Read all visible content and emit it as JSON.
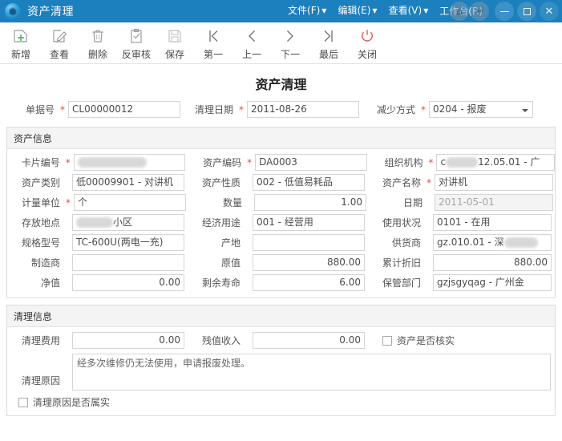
{
  "titlebar": {
    "app_title": "资产清理",
    "logo_icon": "app-logo-icon",
    "menus": [
      {
        "label": "文件(F)",
        "name": "menu-file"
      },
      {
        "label": "编辑(E)",
        "name": "menu-edit"
      },
      {
        "label": "查看(V)",
        "name": "menu-view"
      },
      {
        "label": "工作台(R)",
        "name": "menu-workbench"
      }
    ],
    "overlay_badges": [
      {
        "icon": "hanger-icon",
        "glyph": "⌂"
      },
      {
        "icon": "pin-icon",
        "glyph": "✄"
      }
    ],
    "window_controls": [
      {
        "name": "minimize-button",
        "icon": "minimize-icon"
      },
      {
        "name": "maximize-button",
        "icon": "maximize-icon"
      },
      {
        "name": "close-button",
        "icon": "close-icon",
        "glyph": "✕"
      }
    ],
    "accent_color": "#1c7fbe"
  },
  "toolbar": {
    "buttons": [
      {
        "label": "新增",
        "icon": "add-icon",
        "name": "toolbar-add"
      },
      {
        "label": "查看",
        "icon": "edit-view-icon",
        "name": "toolbar-view"
      },
      {
        "label": "删除",
        "icon": "trash-icon",
        "name": "toolbar-delete"
      },
      {
        "label": "反审核",
        "icon": "unaudit-clipboard-icon",
        "name": "toolbar-unaudit"
      },
      {
        "label": "保存",
        "icon": "save-floppy-icon",
        "name": "toolbar-save"
      },
      {
        "label": "第一",
        "icon": "first-record-icon",
        "name": "toolbar-first"
      },
      {
        "label": "上一",
        "icon": "prev-record-icon",
        "name": "toolbar-prev"
      },
      {
        "label": "下一",
        "icon": "next-record-icon",
        "name": "toolbar-next"
      },
      {
        "label": "最后",
        "icon": "last-record-icon",
        "name": "toolbar-last"
      },
      {
        "label": "关闭",
        "icon": "power-close-icon",
        "name": "toolbar-close"
      }
    ],
    "close_icon_color": "#e05a5a"
  },
  "page": {
    "title": "资产清理",
    "header": {
      "doc_no": {
        "label": "单据号",
        "required": true,
        "value": "CL00000012"
      },
      "clear_date": {
        "label": "清理日期",
        "required": true,
        "value": "2011-08-26"
      },
      "decrease_type": {
        "label": "减少方式",
        "required": true,
        "value": "0204 - 报废",
        "options": [
          "0204 - 报废"
        ]
      }
    },
    "asset_section": {
      "title": "资产信息",
      "fields": {
        "card_no": {
          "label": "卡片编号",
          "required": true,
          "value": "",
          "redacted": true
        },
        "asset_code": {
          "label": "资产编码",
          "required": true,
          "value": "DA0003"
        },
        "org_unit": {
          "label": "组织机构",
          "required": true,
          "value": "12.05.01  - 广",
          "prefix": "c",
          "redacted": true
        },
        "asset_category": {
          "label": "资产类别",
          "required": false,
          "value": "低00009901 - 对讲机"
        },
        "asset_nature": {
          "label": "资产性质",
          "required": false,
          "value": "002 - 低值易耗品"
        },
        "asset_name": {
          "label": "资产名称",
          "required": true,
          "value": "对讲机"
        },
        "unit": {
          "label": "计量单位",
          "required": true,
          "value": "个"
        },
        "quantity": {
          "label": "数量",
          "required": false,
          "value": "1.00"
        },
        "date": {
          "label": "日期",
          "required": false,
          "value": "2011-05-01",
          "readonly": true
        },
        "location": {
          "label": "存放地点",
          "required": false,
          "value": "小区",
          "redacted": true
        },
        "economic_use": {
          "label": "经济用途",
          "required": false,
          "value": "001 - 经营用"
        },
        "usage_status": {
          "label": "使用状况",
          "required": false,
          "value": "0101 - 在用"
        },
        "spec_model": {
          "label": "规格型号",
          "required": false,
          "value": "TC-600U(两电一充)"
        },
        "origin": {
          "label": "产地",
          "required": false,
          "value": ""
        },
        "supplier": {
          "label": "供货商",
          "required": false,
          "value": "gz.010.01 - 深",
          "redacted": true
        },
        "manufacturer": {
          "label": "制造商",
          "required": false,
          "value": ""
        },
        "original_value": {
          "label": "原值",
          "required": false,
          "value": "880.00"
        },
        "accum_depreciation": {
          "label": "累计折旧",
          "required": false,
          "value": "880.00"
        },
        "net_value": {
          "label": "净值",
          "required": false,
          "value": "0.00"
        },
        "remaining_life": {
          "label": "剩余寿命",
          "required": false,
          "value": "6.00"
        },
        "custody_dept": {
          "label": "保管部门",
          "required": false,
          "value": "gzjsgyqag  - 广州金"
        }
      }
    },
    "clear_section": {
      "title": "清理信息",
      "fields": {
        "clear_cost": {
          "label": "清理费用",
          "value": "0.00"
        },
        "salvage_income": {
          "label": "残值收入",
          "value": "0.00"
        },
        "asset_verified": {
          "label": "资产是否核实",
          "checked": false
        },
        "clear_reason": {
          "label": "清理原因",
          "value": "经多次维修仍无法使用，申请报废处理。"
        },
        "reason_truthful": {
          "label": "清理原因是否属实",
          "checked": false
        }
      }
    }
  }
}
